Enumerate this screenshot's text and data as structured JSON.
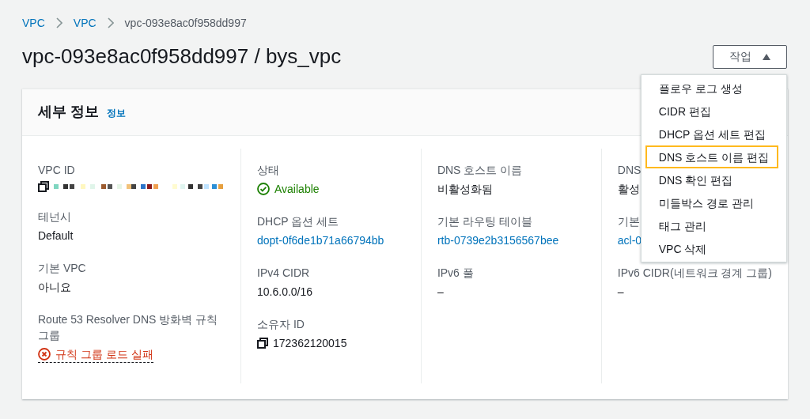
{
  "breadcrumbs": [
    {
      "label": "VPC",
      "kind": "link"
    },
    {
      "label": "VPC",
      "kind": "link"
    },
    {
      "label": "vpc-093e8ac0f958dd997",
      "kind": "current"
    }
  ],
  "title": "vpc-093e8ac0f958dd997 / bys_vpc",
  "actions_button": {
    "label": "작업",
    "expanded": true
  },
  "actions_menu": [
    {
      "label": "플로우 로그 생성",
      "selected": false
    },
    {
      "label": "CIDR 편집",
      "selected": false
    },
    {
      "label": "DHCP 옵션 세트 편집",
      "selected": false
    },
    {
      "label": "DNS 호스트 이름 편집",
      "selected": true
    },
    {
      "label": "DNS 확인 편집",
      "selected": false
    },
    {
      "label": "미들박스 경로 관리",
      "selected": false
    },
    {
      "label": "태그 관리",
      "selected": false
    },
    {
      "label": "VPC 삭제",
      "selected": false
    }
  ],
  "details": {
    "title": "세부 정보",
    "info_link": "정보",
    "columns": [
      [
        {
          "label": "VPC ID",
          "kind": "redacted"
        },
        {
          "label": "테넌시",
          "value": "Default",
          "kind": "text"
        },
        {
          "label": "기본 VPC",
          "value": "아니요",
          "kind": "text"
        },
        {
          "label": "Route 53 Resolver DNS 방화벽 규칙 그룹",
          "value": "규칙 그룹 로드 실패",
          "kind": "error"
        }
      ],
      [
        {
          "label": "상태",
          "value": "Available",
          "kind": "status"
        },
        {
          "label": "DHCP 옵션 세트",
          "value": "dopt-0f6de1b71a66794bb",
          "kind": "link"
        },
        {
          "label": "IPv4 CIDR",
          "value": "10.6.0.0/16",
          "kind": "text"
        },
        {
          "label": "소유자 ID",
          "value": "172362120015",
          "kind": "copy"
        }
      ],
      [
        {
          "label": "DNS 호스트 이름",
          "value": "비활성화됨",
          "kind": "text"
        },
        {
          "label": "기본 라우팅 테이블",
          "value": "rtb-0739e2b3156567bee",
          "kind": "link"
        },
        {
          "label": "IPv6 풀",
          "value": "–",
          "kind": "text"
        }
      ],
      [
        {
          "label": "DNS",
          "value": "활성",
          "kind": "text"
        },
        {
          "label": "기본",
          "value": "acl-0",
          "kind": "link"
        },
        {
          "label": "IPv6 CIDR(네트워크 경계 그룹)",
          "value": "–",
          "kind": "text"
        }
      ]
    ]
  }
}
